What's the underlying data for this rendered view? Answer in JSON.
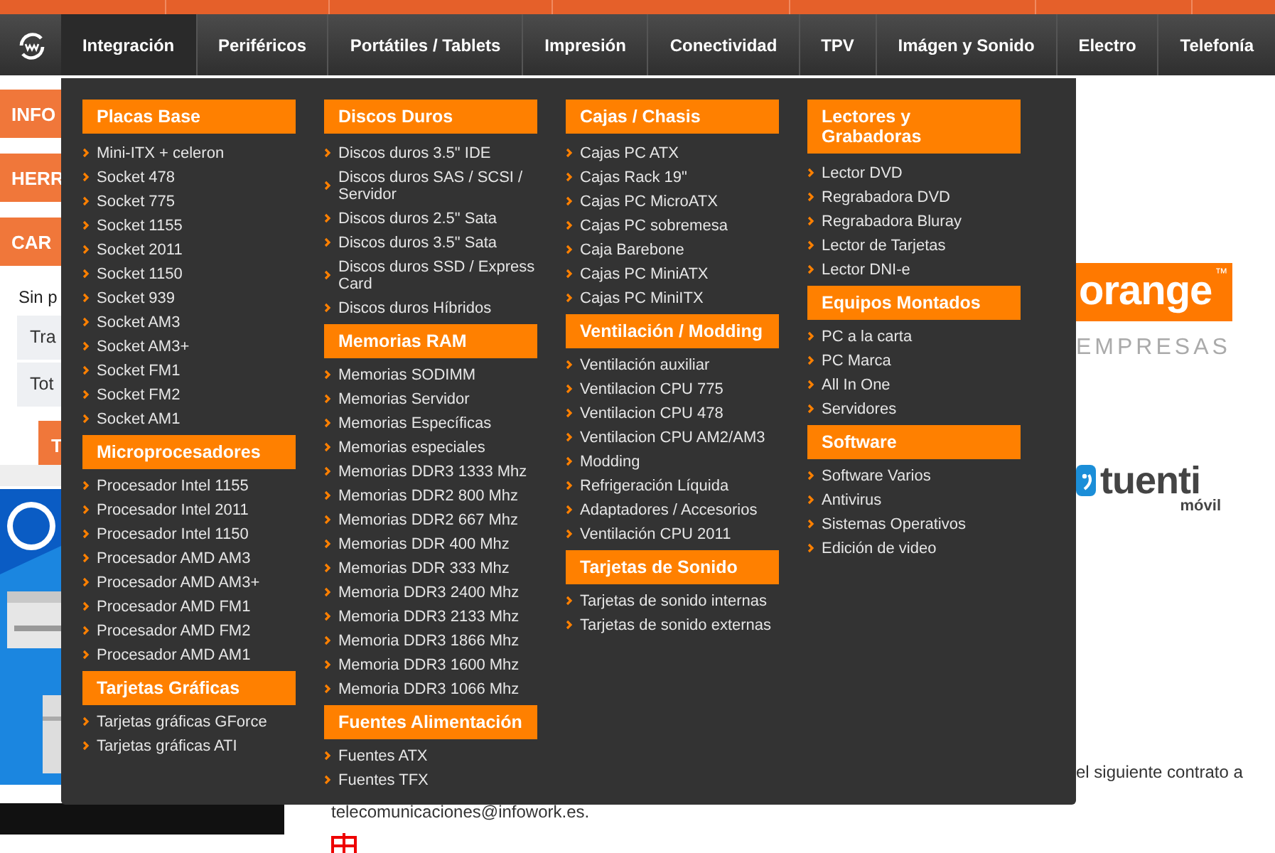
{
  "nav": {
    "items": [
      {
        "label": "Integración",
        "selected": true
      },
      {
        "label": "Periféricos",
        "selected": false
      },
      {
        "label": "Portátiles / Tablets",
        "selected": false
      },
      {
        "label": "Impresión",
        "selected": false
      },
      {
        "label": "Conectividad",
        "selected": false
      },
      {
        "label": "TPV",
        "selected": false
      },
      {
        "label": "Imágen y Sonido",
        "selected": false
      },
      {
        "label": "Electro",
        "selected": false
      },
      {
        "label": "Telefonía",
        "selected": false
      }
    ]
  },
  "menu": {
    "columns": [
      [
        {
          "title": "Placas Base",
          "items": [
            "Mini-ITX + celeron",
            "Socket 478",
            "Socket 775",
            "Socket 1155",
            "Socket 2011",
            "Socket 1150",
            "Socket 939",
            "Socket AM3",
            "Socket AM3+",
            "Socket FM1",
            "Socket FM2",
            "Socket AM1"
          ]
        },
        {
          "title": "Microprocesadores",
          "items": [
            "Procesador Intel 1155",
            "Procesador Intel 2011",
            "Procesador Intel 1150",
            "Procesador AMD AM3",
            "Procesador AMD AM3+",
            "Procesador AMD FM1",
            "Procesador AMD FM2",
            "Procesador AMD AM1"
          ]
        },
        {
          "title": "Tarjetas Gráficas",
          "items": [
            "Tarjetas gráficas GForce",
            "Tarjetas gráficas ATI"
          ]
        }
      ],
      [
        {
          "title": "Discos Duros",
          "items": [
            "Discos duros 3.5\" IDE",
            "Discos duros SAS / SCSI / Servidor",
            "Discos duros 2.5\" Sata",
            "Discos duros 3.5\" Sata",
            "Discos duros SSD / Express Card",
            "Discos duros Híbridos"
          ]
        },
        {
          "title": "Memorias RAM",
          "items": [
            "Memorias SODIMM",
            "Memorias Servidor",
            "Memorias Específicas",
            "Memorias especiales",
            "Memorias DDR3 1333 Mhz",
            "Memorias DDR2 800 Mhz",
            "Memorias DDR2 667 Mhz",
            "Memorias DDR 400 Mhz",
            "Memorias DDR 333 Mhz",
            "Memoria DDR3 2400 Mhz",
            "Memoria DDR3 2133 Mhz",
            "Memoria DDR3 1866 Mhz",
            "Memoria DDR3 1600 Mhz",
            "Memoria DDR3 1066 Mhz"
          ]
        },
        {
          "title": "Fuentes Alimentación",
          "items": [
            "Fuentes ATX",
            "Fuentes TFX"
          ]
        }
      ],
      [
        {
          "title": "Cajas / Chasis",
          "items": [
            "Cajas PC ATX",
            "Cajas Rack 19\"",
            "Cajas PC MicroATX",
            "Cajas PC sobremesa",
            "Caja Barebone",
            "Cajas PC MiniATX",
            "Cajas PC MiniITX"
          ]
        },
        {
          "title": "Ventilación / Modding",
          "items": [
            "Ventilación auxiliar",
            "Ventilacion CPU 775",
            "Ventilacion CPU 478",
            "Ventilacion CPU AM2/AM3",
            "Modding",
            "Refrigeración Líquida",
            "Adaptadores / Accesorios",
            "Ventilación CPU 2011"
          ]
        },
        {
          "title": "Tarjetas de Sonido",
          "items": [
            "Tarjetas de sonido internas",
            "Tarjetas de sonido externas"
          ]
        }
      ],
      [
        {
          "title": "Lectores y\nGrabadoras",
          "items": [
            "Lector DVD",
            "Regrabadora DVD",
            "Regrabadora Bluray",
            "Lector de Tarjetas",
            "Lector DNI-e"
          ]
        },
        {
          "title": "Equipos Montados",
          "items": [
            "PC a la carta",
            "PC Marca",
            "All In One",
            "Servidores"
          ]
        },
        {
          "title": "Software",
          "items": [
            "Software Varios",
            "Antivirus",
            "Sistemas Operativos",
            "Edición de video"
          ]
        }
      ]
    ]
  },
  "sidebar": {
    "buttons": [
      "INFO",
      "HERR",
      "CAR"
    ],
    "cart_text": "Sin p",
    "cart_rows": [
      "Tra",
      "Tot"
    ],
    "cart_button": "T"
  },
  "logos": {
    "orange": "orange",
    "orange_mark": "™",
    "orange_sub": "EMPRESAS",
    "tuenti": "tuenti",
    "tuenti_sub": "móvil"
  },
  "content": {
    "contract_text": "el siguiente contrato a",
    "email": "telecomunicaciones@infowork.es."
  }
}
